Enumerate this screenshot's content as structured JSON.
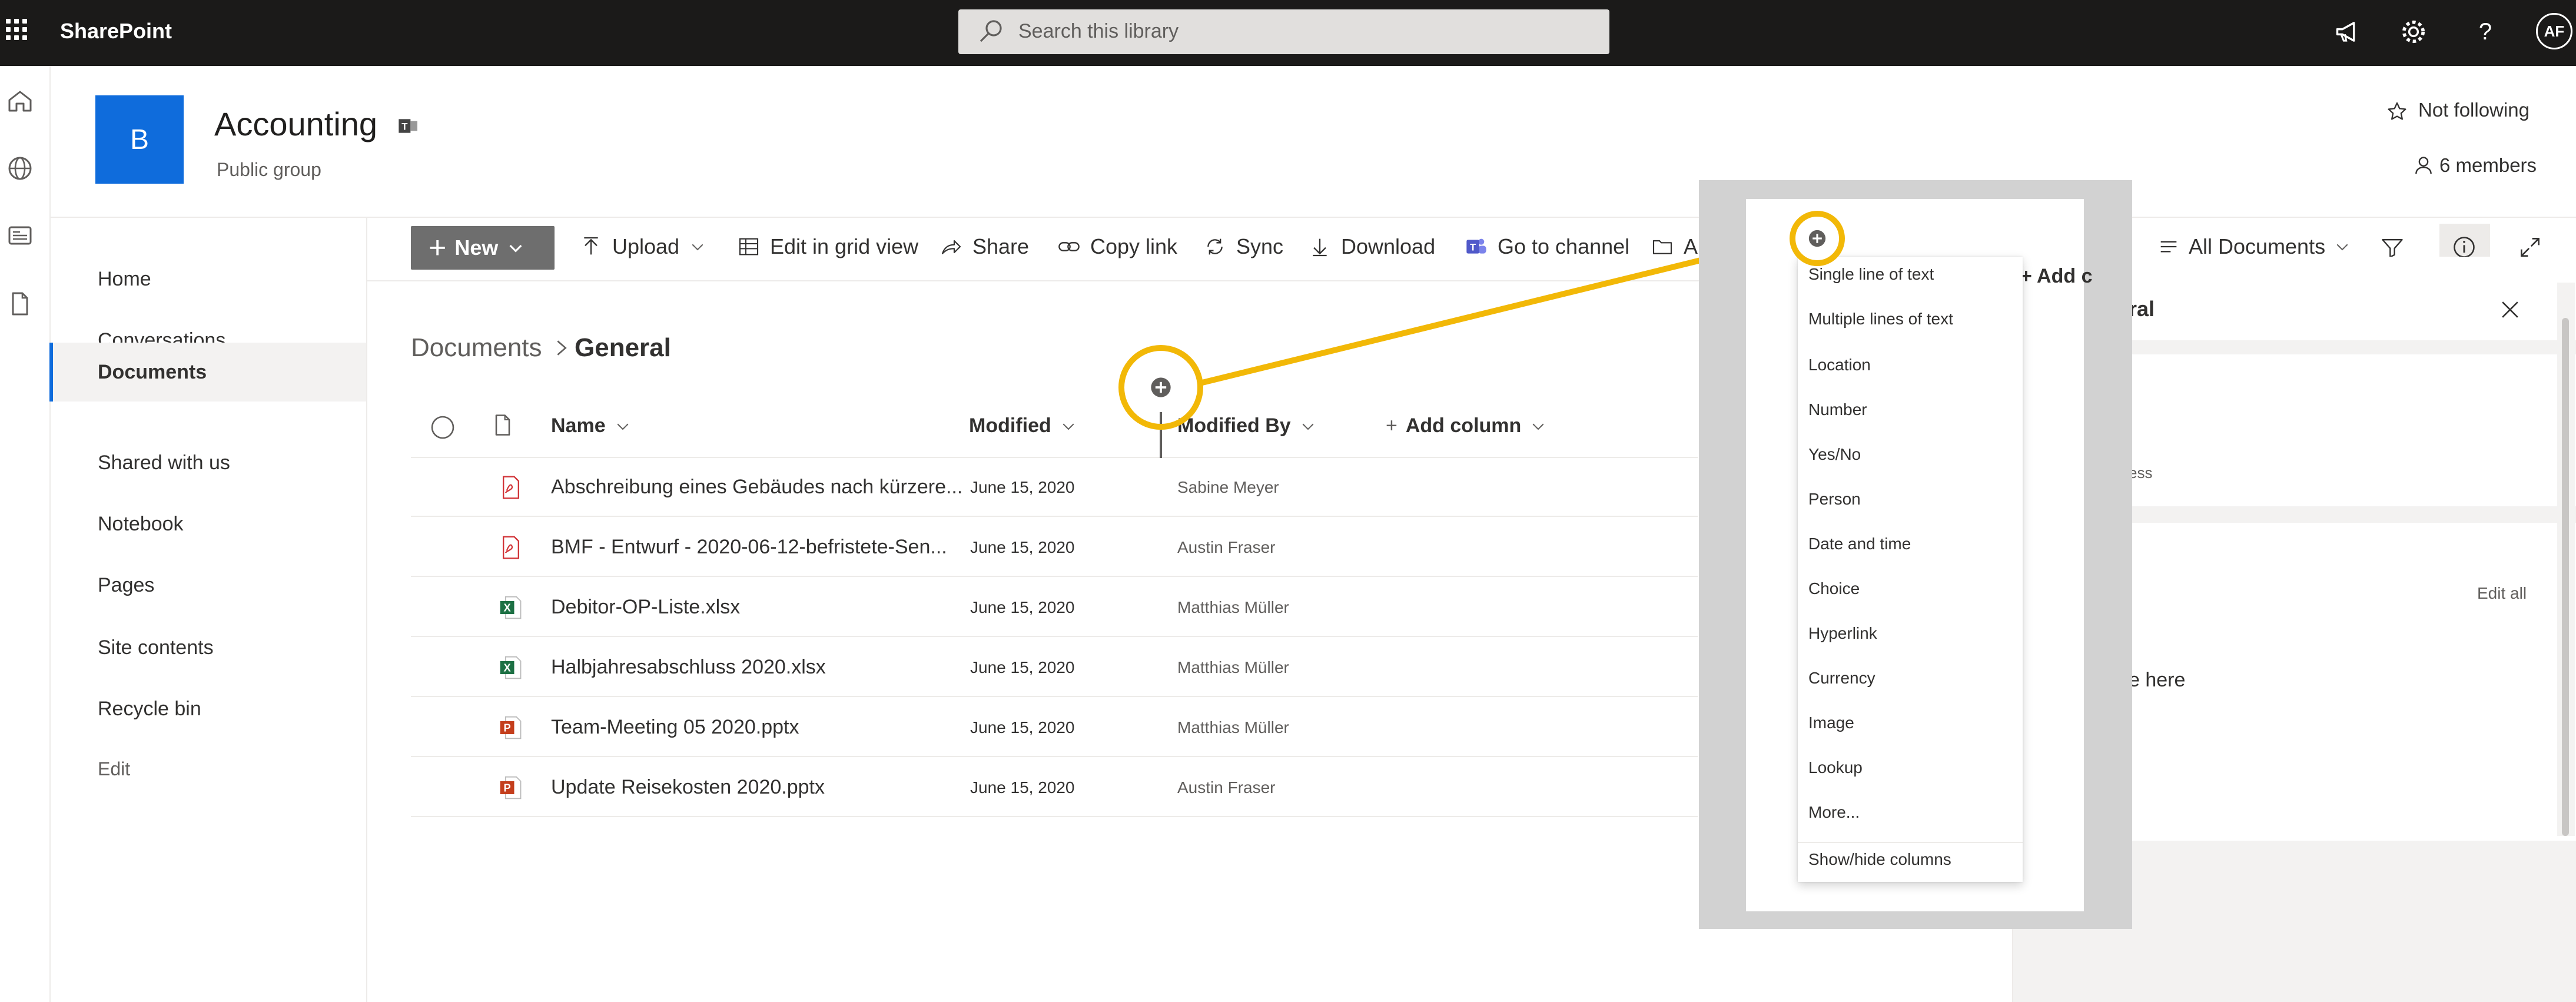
{
  "suitebar": {
    "app_name": "SharePoint",
    "search_placeholder": "Search this library",
    "user_initials": "AF"
  },
  "site": {
    "logo_letter": "B",
    "title": "Accounting",
    "subtitle": "Public group",
    "follow_label": "Not following",
    "members_label": "6 members"
  },
  "left_nav": {
    "items": [
      "Home",
      "Conversations",
      "Documents",
      "Shared with us",
      "Notebook",
      "Pages",
      "Site contents",
      "Recycle bin"
    ],
    "selected": "Documents",
    "edit_label": "Edit"
  },
  "command_bar": {
    "new_label": "New",
    "upload_label": "Upload",
    "grid_label": "Edit in grid view",
    "share_label": "Share",
    "copy_link_label": "Copy link",
    "sync_label": "Sync",
    "download_label": "Download",
    "channel_label": "Go to channel",
    "truncated_label": "A",
    "view_label": "All Documents"
  },
  "breadcrumb": {
    "root": "Documents",
    "current": "General"
  },
  "list": {
    "columns": {
      "name": "Name",
      "modified": "Modified",
      "modified_by": "Modified By",
      "add_column": "Add column"
    },
    "rows": [
      {
        "name": "Abschreibung eines Gebäudes nach kürzere...",
        "modified": "June 15, 2020",
        "modified_by": "Sabine Meyer",
        "icon": "pdf-icon"
      },
      {
        "name": "BMF - Entwurf - 2020-06-12-befristete-Sen...",
        "modified": "June 15, 2020",
        "modified_by": "Austin Fraser",
        "icon": "pdf-icon"
      },
      {
        "name": "Debitor-OP-Liste.xlsx",
        "modified": "June 15, 2020",
        "modified_by": "Matthias Müller",
        "icon": "excel-icon"
      },
      {
        "name": "Halbjahresabschluss 2020.xlsx",
        "modified": "June 15, 2020",
        "modified_by": "Matthias Müller",
        "icon": "excel-icon"
      },
      {
        "name": "Team-Meeting 05 2020.pptx",
        "modified": "June 15, 2020",
        "modified_by": "Matthias Müller",
        "icon": "powerpoint-icon"
      },
      {
        "name": "Update Reisekosten 2020.pptx",
        "modified": "June 15, 2020",
        "modified_by": "Austin Fraser",
        "icon": "powerpoint-icon"
      }
    ]
  },
  "add_column_menu": {
    "items": [
      "Single line of text",
      "Multiple lines of text",
      "Location",
      "Number",
      "Yes/No",
      "Person",
      "Date and time",
      "Choice",
      "Hyperlink",
      "Currency",
      "Image",
      "Lookup",
      "More..."
    ],
    "footer": "Show/hide columns",
    "partial_add_column": "+ Add c"
  },
  "detail_pane": {
    "title_fragment": "ral",
    "access_fragment": "ess",
    "edit_all": "Edit all",
    "here_fragment": "e here"
  },
  "colors": {
    "suitebar": "#1b1a19",
    "accent": "#0f6cdc",
    "callout": "#f2b807",
    "excel": "#1d7044",
    "powerpoint": "#c43e1c",
    "pdf": "#d13438"
  }
}
